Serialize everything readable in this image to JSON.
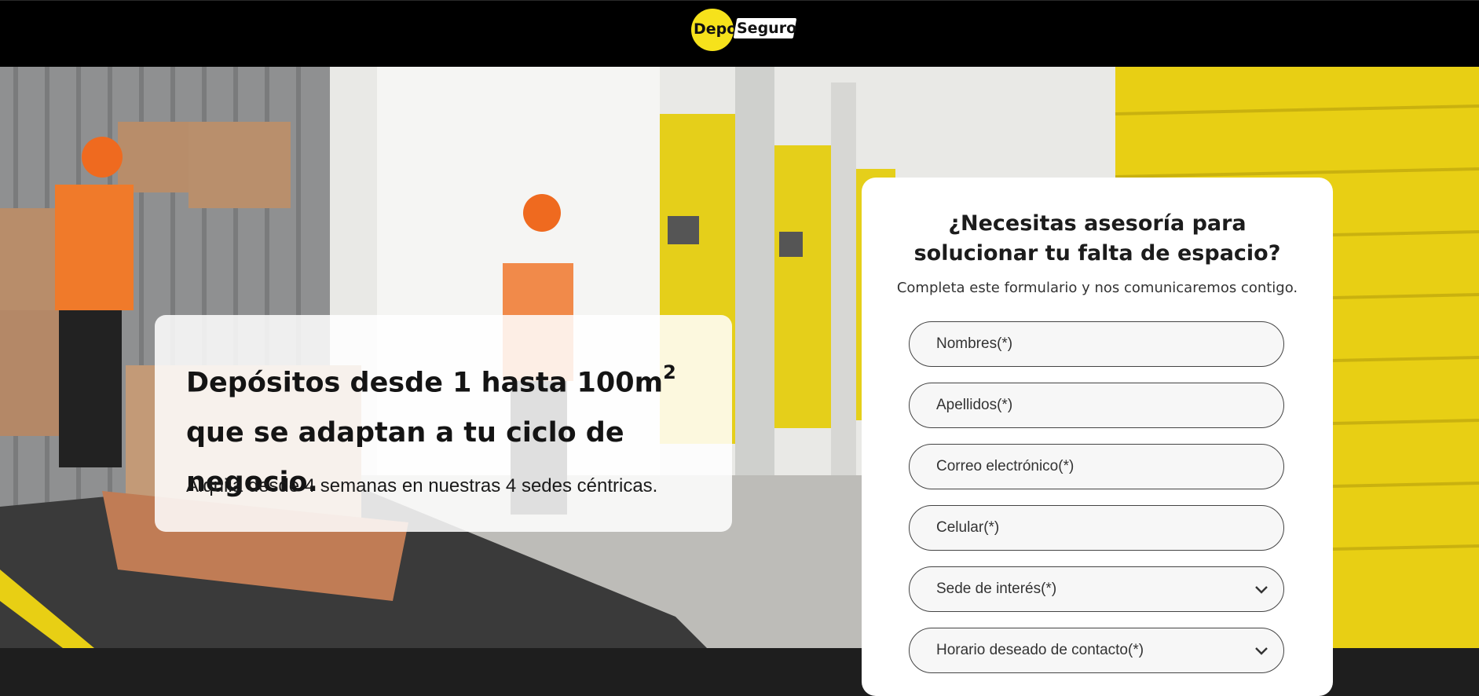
{
  "header": {
    "logo_part1": "Depo",
    "logo_part2": "Seguro"
  },
  "hero": {
    "title_main": "Depósitos desde 1 hasta 100m",
    "title_sup": "2",
    "title_rest": " que se adaptan a tu ciclo de negocio.",
    "subtitle": "Alquila desde 4 semanas en nuestras 4 sedes céntricas."
  },
  "form": {
    "title": "¿Necesitas asesoría para solucionar tu falta de espacio?",
    "subtitle": "Completa este formulario y nos comunicaremos contigo.",
    "fields": [
      {
        "placeholder": "Nombres(*)"
      },
      {
        "placeholder": "Apellidos(*)"
      },
      {
        "placeholder": "Correo electrónico(*)"
      },
      {
        "placeholder": "Celular(*)"
      },
      {
        "placeholder": "Sede de interés(*)"
      },
      {
        "placeholder": "Horario deseado de contacto(*)"
      }
    ]
  },
  "colors": {
    "brand_yellow": "#f6e21b",
    "header_bg": "#000000",
    "footer_bg": "#1e1e1e"
  },
  "icons": {
    "select_arrow": "chevron-down-icon"
  }
}
